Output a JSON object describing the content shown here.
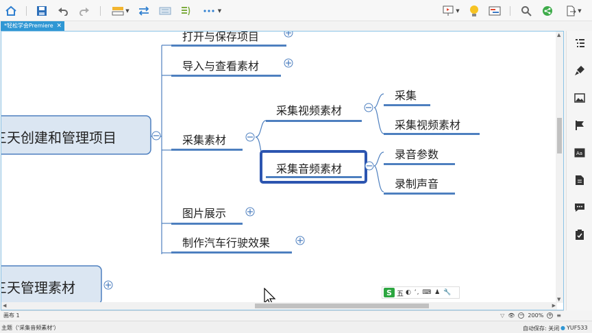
{
  "colors": {
    "accent": "#2f97d4",
    "branch": "#4d7fbf",
    "main_fill": "#dbe6f2",
    "selection": "#2c55b0"
  },
  "toolbar": {
    "icons": [
      "home-icon",
      "save-icon",
      "undo-icon",
      "redo-icon",
      "topic-style-icon",
      "relationship-icon",
      "boundary-icon",
      "summary-icon",
      "more-icon",
      "presentation-icon",
      "idea-icon",
      "gantt-icon",
      "search-icon",
      "share-icon",
      "export-icon"
    ]
  },
  "tab": {
    "title": "*轻松学会Premiere",
    "close": "✕"
  },
  "mindmap": {
    "top_partial": "打开与保存项目",
    "main_topic": "三天创建和管理项目",
    "main_topic_2": "三天管理素材",
    "subtopics": {
      "import": "导入与查看素材",
      "collect": "采集素材",
      "picture": "图片展示",
      "car": "制作汽车行驶效果"
    },
    "collect_children": {
      "video": "采集视频素材",
      "audio": "采集音频素材"
    },
    "video_children": {
      "collect": "采集",
      "collect_video": "采集视频素材"
    },
    "audio_children": {
      "params": "录音参数",
      "record": "录制声音"
    }
  },
  "ime": {
    "logo": "S",
    "mode": "五",
    "glyphs": "◐ ʻ, ⌨ ♟ 🔧"
  },
  "canvasbar": {
    "sheet": "画布 1",
    "zoom": "200%"
  },
  "statusbar": {
    "topic": "主题（'采集音频素材'）",
    "autosave": "自动保存: 关闭",
    "user": "YUF533"
  }
}
